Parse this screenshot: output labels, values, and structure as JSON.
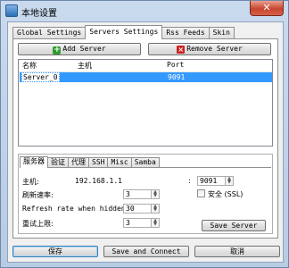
{
  "window": {
    "title": "本地设置",
    "close_glyph": "✕"
  },
  "top_tabs": [
    "Global Settings",
    "Servers Settings",
    "Rss Feeds",
    "Skin"
  ],
  "servers": {
    "add_label": "Add Server",
    "remove_label": "Remove Server",
    "columns": [
      "名称",
      "主机",
      "Port"
    ],
    "rows": [
      {
        "name": "Server_0",
        "host": "",
        "port": "9091"
      }
    ]
  },
  "sub_tabs": [
    "服务器",
    "验证",
    "代理",
    "SSH",
    "Misc",
    "Samba"
  ],
  "server_form": {
    "host_label": "主机:",
    "host_value": "192.168.1.1",
    "colon": ":",
    "port_value": "9091",
    "ssl_label": "安全 (SSL)",
    "refresh_label": "刷新速率:",
    "refresh_value": "3",
    "refresh_hidden_label": "Refresh rate when hidden:",
    "refresh_hidden_value": "30",
    "retry_label": "重试上限:",
    "retry_value": "3",
    "save_server_label": "Save Server"
  },
  "footer": {
    "save_label": "保存",
    "save_connect_label": "Save and Connect",
    "cancel_label": "取消"
  },
  "icons": {
    "add": "plus-icon",
    "remove": "x-icon",
    "spin_up": "▲",
    "spin_down": "▼"
  }
}
